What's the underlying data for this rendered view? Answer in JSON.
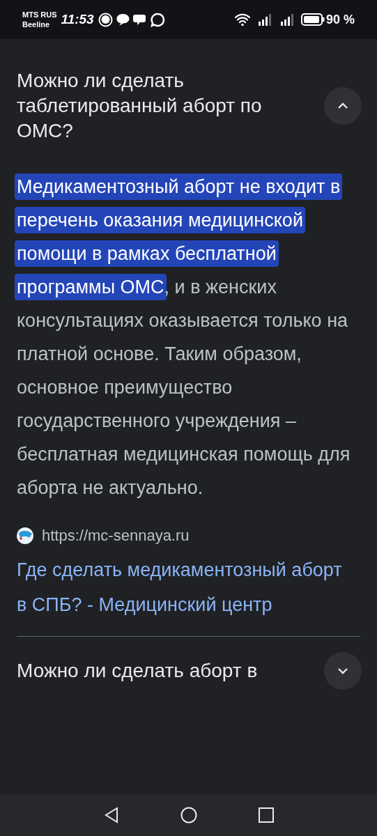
{
  "status_bar": {
    "carriers": [
      "MTS RUS",
      "Beeline"
    ],
    "time": "11:53",
    "battery": "90 %"
  },
  "questions": [
    {
      "question": "Можно ли сделать таблетированный аборт по ОМС?",
      "expanded": true,
      "answer": {
        "highlighted": "Медикаментозный аборт не входит в перечень оказания медицинской помощи в рамках бесплатной программы ОМС",
        "text": ", и в женских консультациях оказывается только на платной основе. Таким образом, основное преимущество государственного учреждения – бесплатная медицинская помощь для аборта не актуально."
      },
      "source": {
        "url": "https://mc-sennaya.ru",
        "title": "Где сделать медикаментозный аборт в СПБ? - Медицинский центр"
      }
    },
    {
      "question": "Можно ли сделать аборт в",
      "expanded": false
    }
  ]
}
